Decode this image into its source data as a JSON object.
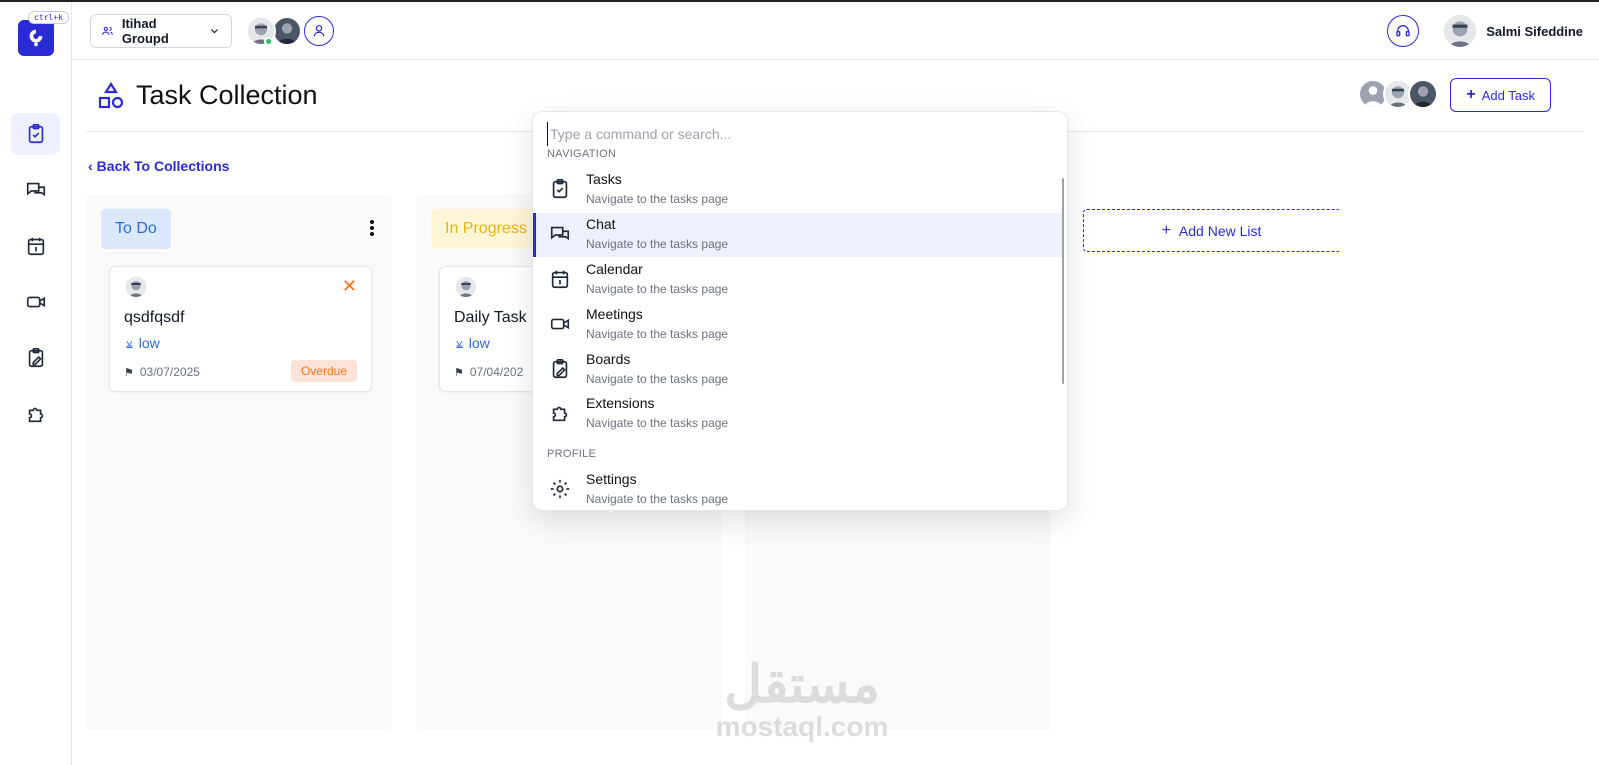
{
  "app": {
    "shortcut": "ctrl+k",
    "group_name": "Itihad Groupd",
    "user_name": "Salmi Sifeddine"
  },
  "sidebar": {
    "items": [
      {
        "name": "tasks",
        "icon": "clipboard-check-icon",
        "active": true
      },
      {
        "name": "chat",
        "icon": "chat-icon",
        "active": false
      },
      {
        "name": "calendar",
        "icon": "calendar-icon",
        "active": false
      },
      {
        "name": "meetings",
        "icon": "video-icon",
        "active": false
      },
      {
        "name": "boards",
        "icon": "clipboard-edit-icon",
        "active": false
      },
      {
        "name": "extensions",
        "icon": "puzzle-icon",
        "active": false
      }
    ]
  },
  "page": {
    "title": "Task Collection",
    "add_task_label": "Add Task",
    "back_label": "Back To Collections",
    "add_list_label": "Add New List"
  },
  "columns": [
    {
      "title": "To Do",
      "badge_bg": "#dbe7fb",
      "badge_color": "#2b6cd6",
      "card": {
        "title": "qsdfqsdf",
        "priority": "low",
        "date": "03/07/2025",
        "status": "Overdue"
      }
    },
    {
      "title": "In Progress",
      "badge_bg": "#fef6d6",
      "badge_color": "#eab308",
      "card": {
        "title": "Daily Task",
        "priority": "low",
        "date": "07/04/202"
      }
    }
  ],
  "palette": {
    "placeholder": "Type a command or search...",
    "groups": [
      {
        "label": "NAVIGATION",
        "items": [
          {
            "label": "Tasks",
            "desc": "Navigate to the tasks page",
            "icon": "clipboard-check-icon"
          },
          {
            "label": "Chat",
            "desc": "Navigate to the tasks page",
            "icon": "chat-icon",
            "active": true
          },
          {
            "label": "Calendar",
            "desc": "Navigate to the tasks page",
            "icon": "calendar-icon"
          },
          {
            "label": "Meetings",
            "desc": "Navigate to the tasks page",
            "icon": "video-icon"
          },
          {
            "label": "Boards",
            "desc": "Navigate to the tasks page",
            "icon": "clipboard-edit-icon"
          },
          {
            "label": "Extensions",
            "desc": "Navigate to the tasks page",
            "icon": "puzzle-icon"
          }
        ]
      },
      {
        "label": "PROFILE",
        "items": [
          {
            "label": "Settings",
            "desc": "Navigate to the tasks page",
            "icon": "gear-icon"
          }
        ]
      }
    ]
  },
  "watermark": {
    "arabic": "مستقل",
    "latin": "mostaql.com"
  },
  "colors": {
    "accent": "#2b2bd6",
    "overdue": "#f97316"
  }
}
